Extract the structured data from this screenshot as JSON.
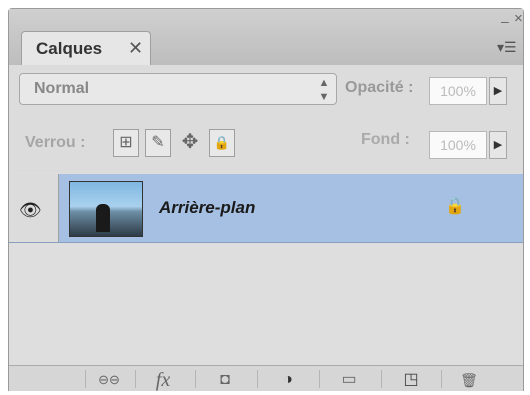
{
  "panel": {
    "tab_label": "Calques",
    "tab_close": "✕",
    "window_min": "–",
    "window_close": "×",
    "menu_icon": "▾☰"
  },
  "blend": {
    "mode": "Normal",
    "arrows_up": "▲",
    "arrows_down": "▼",
    "opacity_label": "Opacité :",
    "opacity_value": "100%"
  },
  "lock": {
    "label": "Verrou :",
    "fill_label": "Fond :",
    "fill_value": "100%",
    "icons": [
      "lock-transparent-icon",
      "brush-icon",
      "move-icon",
      "lock-all-icon"
    ]
  },
  "layers": [
    {
      "name": "Arrière-plan",
      "visible": true,
      "locked": true,
      "selected": true
    }
  ],
  "bottom_icons": [
    "link-icon",
    "fx-icon",
    "mask-icon",
    "adjustment-icon",
    "folder-icon",
    "new-layer-icon",
    "trash-icon"
  ],
  "glyphs": {
    "eye": "👁",
    "lock": "🔒",
    "play": "▶",
    "fx": "fx",
    "link": "⊖⊖",
    "mask": "◘",
    "adjust": "◑",
    "folder": "▭",
    "newlayer": "◳",
    "trash": "🗑",
    "brush": "✎",
    "move": "✥",
    "checker": "⊞"
  }
}
